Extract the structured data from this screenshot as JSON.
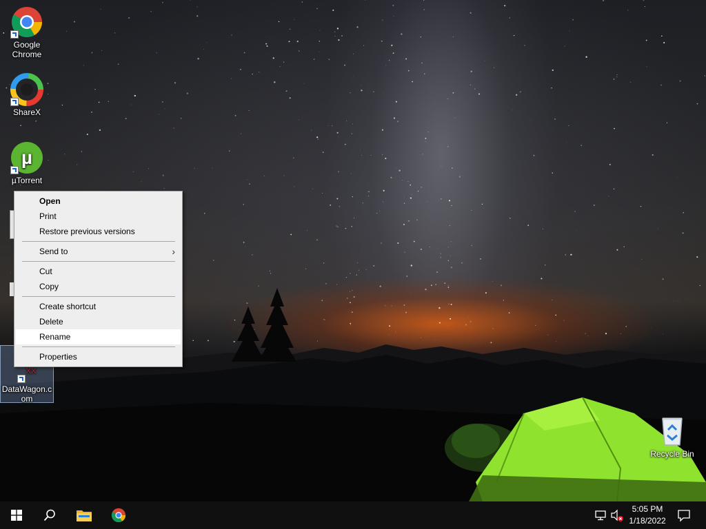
{
  "desktop": {
    "icons": [
      {
        "label": "Google Chrome"
      },
      {
        "label": "ShareX"
      },
      {
        "label": "µTorrent"
      },
      {
        "label": "DataWagon.com"
      },
      {
        "label": "Recycle Bin"
      }
    ]
  },
  "context_menu": {
    "items": [
      {
        "label": "Open"
      },
      {
        "label": "Print"
      },
      {
        "label": "Restore previous versions"
      },
      {
        "label": "Send to"
      },
      {
        "label": "Cut"
      },
      {
        "label": "Copy"
      },
      {
        "label": "Create shortcut"
      },
      {
        "label": "Delete"
      },
      {
        "label": "Rename"
      },
      {
        "label": "Properties"
      }
    ]
  },
  "taskbar": {
    "clock_time": "5:05 PM",
    "clock_date": "1/18/2022",
    "icons": [
      "windows-start-icon",
      "search-icon",
      "file-explorer-icon",
      "chrome-icon",
      "network-icon",
      "volume-muted-icon",
      "action-center-icon"
    ]
  },
  "colors": {
    "taskbar": "#101010",
    "menu_bg": "#eeeeee",
    "menu_hover": "#ffffff",
    "tent_green": "#8fe22e",
    "horizon_orange": "#d65c14"
  }
}
